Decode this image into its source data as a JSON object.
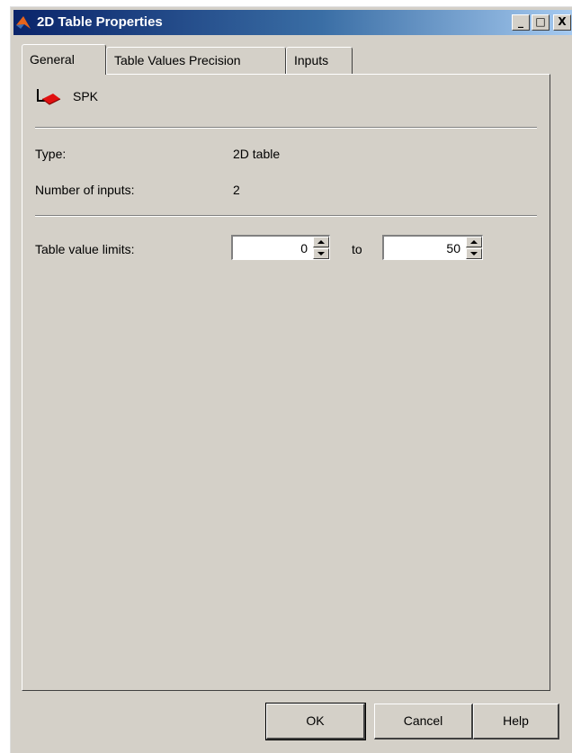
{
  "window": {
    "title": "2D Table Properties"
  },
  "titlebar_buttons": {
    "minimize": "_",
    "maximize": "□",
    "close": "X"
  },
  "tabs": [
    {
      "label": "General",
      "active": true
    },
    {
      "label": "Table Values Precision",
      "active": false
    },
    {
      "label": "Inputs",
      "active": false
    }
  ],
  "block": {
    "name": "SPK",
    "icon": "table-block-icon"
  },
  "info": {
    "type_label": "Type:",
    "type_value": "2D table",
    "inputs_label": "Number of inputs:",
    "inputs_value": "2"
  },
  "limits": {
    "label": "Table value limits:",
    "min_value": "0",
    "to_label": "to",
    "max_value": "50"
  },
  "buttons": {
    "ok": "OK",
    "cancel": "Cancel",
    "help": "Help"
  },
  "colors": {
    "titlebar_start": "#0a246a",
    "face": "#d4d0c8"
  }
}
